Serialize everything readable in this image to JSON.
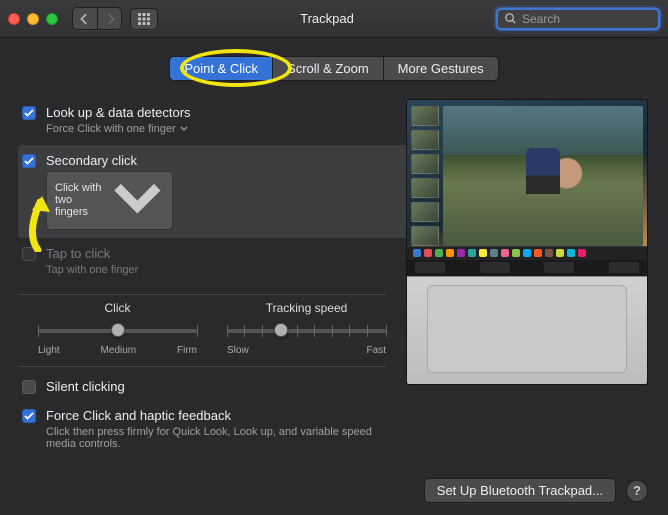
{
  "toolbar": {
    "title": "Trackpad",
    "search_placeholder": "Search"
  },
  "tabs": [
    {
      "label": "Point & Click",
      "active": true
    },
    {
      "label": "Scroll & Zoom",
      "active": false
    },
    {
      "label": "More Gestures",
      "active": false
    }
  ],
  "options": {
    "lookup": {
      "checked": true,
      "title": "Look up & data detectors",
      "sub": "Force Click with one finger"
    },
    "secondary": {
      "checked": true,
      "selected": true,
      "title": "Secondary click",
      "sub": "Click with two fingers"
    },
    "tap": {
      "checked": false,
      "disabled": true,
      "title": "Tap to click",
      "sub": "Tap with one finger"
    },
    "silent": {
      "checked": false,
      "title": "Silent clicking"
    },
    "force": {
      "checked": true,
      "title": "Force Click and haptic feedback",
      "sub": "Click then press firmly for Quick Look, Look up, and variable speed media controls."
    }
  },
  "sliders": {
    "click": {
      "title": "Click",
      "left": "Light",
      "mid": "Medium",
      "right": "Firm",
      "value_pct": 50
    },
    "tracking": {
      "title": "Tracking speed",
      "left": "Slow",
      "right": "Fast",
      "value_pct": 34
    }
  },
  "footer": {
    "setup": "Set Up Bluetooth Trackpad...",
    "help": "?"
  }
}
